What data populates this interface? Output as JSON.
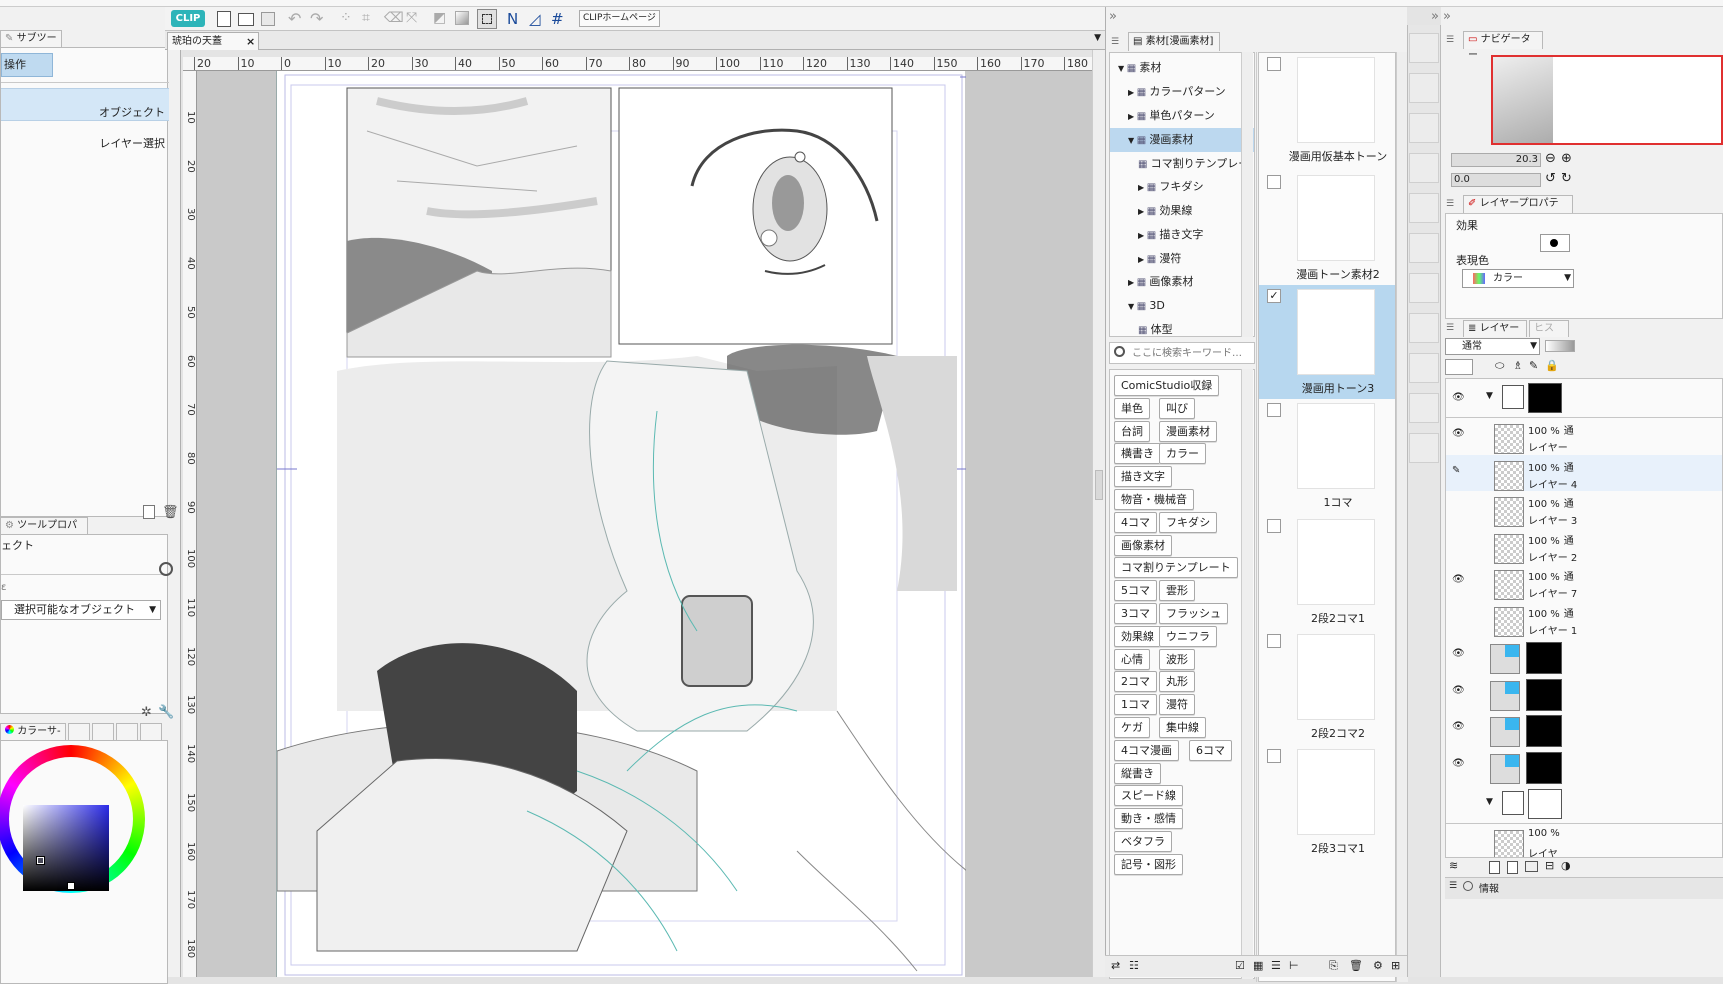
{
  "toolbar": {
    "clip_logo": "CLIP",
    "homepage_button": "CLIPホームページ"
  },
  "left": {
    "subtool_tab": "サブツール",
    "subtool_group": "操作",
    "object_label": "オブジェクト",
    "layer_select_label": "レイヤー選択",
    "toolprop_tab": "ツールプロパティ",
    "toolprop_title": "ェクト",
    "select_dropdown": "選択可能なオブジェクト",
    "color_tab": "カラーサ-"
  },
  "document": {
    "tab_title": "琥珀の天蓋",
    "ruler_top": [
      "20",
      "10",
      "0",
      "10",
      "20",
      "30",
      "40",
      "50",
      "60",
      "70",
      "80",
      "90",
      "100",
      "110",
      "120",
      "130",
      "140",
      "150",
      "160",
      "170",
      "180"
    ],
    "ruler_left": [
      "10",
      "20",
      "30",
      "40",
      "50",
      "60",
      "70",
      "80",
      "90",
      "100",
      "110",
      "120",
      "130",
      "140",
      "150",
      "160",
      "170",
      "180"
    ]
  },
  "material": {
    "panel_tab": "素材[漫画素材]",
    "tree": [
      {
        "label": "素材",
        "indent": 0
      },
      {
        "label": "カラーパターン",
        "indent": 1
      },
      {
        "label": "単色パターン",
        "indent": 1
      },
      {
        "label": "漫画素材",
        "indent": 1
      },
      {
        "label": "コマ割りテンプレー",
        "indent": 2
      },
      {
        "label": "フキダシ",
        "indent": 2
      },
      {
        "label": "効果線",
        "indent": 2
      },
      {
        "label": "描き文字",
        "indent": 2
      },
      {
        "label": "漫符",
        "indent": 2
      },
      {
        "label": "画像素材",
        "indent": 1
      },
      {
        "label": "3D",
        "indent": 1
      },
      {
        "label": "体型",
        "indent": 2
      }
    ],
    "search_placeholder": "ここに検索キーワード…",
    "tags": [
      [
        "ComicStudio収録"
      ],
      [
        "単色",
        "叫び"
      ],
      [
        "台詞",
        "漫画素材"
      ],
      [
        "横書き",
        "カラー"
      ],
      [
        "描き文字"
      ],
      [
        "物音・機械音"
      ],
      [
        "4コマ",
        "フキダシ"
      ],
      [
        "画像素材"
      ],
      [
        "コマ割りテンプレート"
      ],
      [
        "5コマ",
        "雲形"
      ],
      [
        "3コマ",
        "フラッシュ"
      ],
      [
        "効果線",
        "ウニフラ"
      ],
      [
        "心情",
        "波形"
      ],
      [
        "2コマ",
        "丸形"
      ],
      [
        "1コマ",
        "漫符"
      ],
      [
        "ケガ",
        "集中線"
      ],
      [
        "4コマ漫画",
        "6コマ"
      ],
      [
        "縦書き"
      ],
      [
        "スピード線"
      ],
      [
        "動き・感情"
      ],
      [
        "ベタフラ"
      ],
      [
        "記号・図形"
      ]
    ],
    "items": [
      {
        "label": "漫画用仮基本トーン",
        "checked": false
      },
      {
        "label": "漫画トーン素材2",
        "checked": false
      },
      {
        "label": "漫画用トーン3",
        "checked": true
      },
      {
        "label": "1コマ",
        "checked": false
      },
      {
        "label": "2段2コマ1",
        "checked": false
      },
      {
        "label": "2段2コマ2",
        "checked": false
      },
      {
        "label": "2段3コマ1",
        "checked": false
      }
    ]
  },
  "navigator": {
    "tab": "ナビゲーター",
    "zoom": "20.3",
    "rotate": "0.0"
  },
  "layer_property": {
    "tab": "レイヤープロパティ",
    "effect_label": "効果",
    "color_label": "表現色",
    "color_value": "カラー"
  },
  "layers": {
    "tab": "レイヤー",
    "tab2": "ヒス",
    "blend_mode": "通常",
    "rows": [
      {
        "opacity": "100 %",
        "mode": "通",
        "name": "レイヤー"
      },
      {
        "opacity": "100 %",
        "mode": "通",
        "name": "レイヤー 4"
      },
      {
        "opacity": "100 %",
        "mode": "通",
        "name": "レイヤー 3"
      },
      {
        "opacity": "100 %",
        "mode": "通",
        "name": "レイヤー 2"
      },
      {
        "opacity": "100 %",
        "mode": "通",
        "name": "レイヤー 7"
      },
      {
        "opacity": "100 %",
        "mode": "通",
        "name": "レイヤー 1"
      }
    ],
    "bottom_row": {
      "opacity": "100 %",
      "name": "レイヤ"
    }
  },
  "status": {
    "info_tab": "情報"
  }
}
